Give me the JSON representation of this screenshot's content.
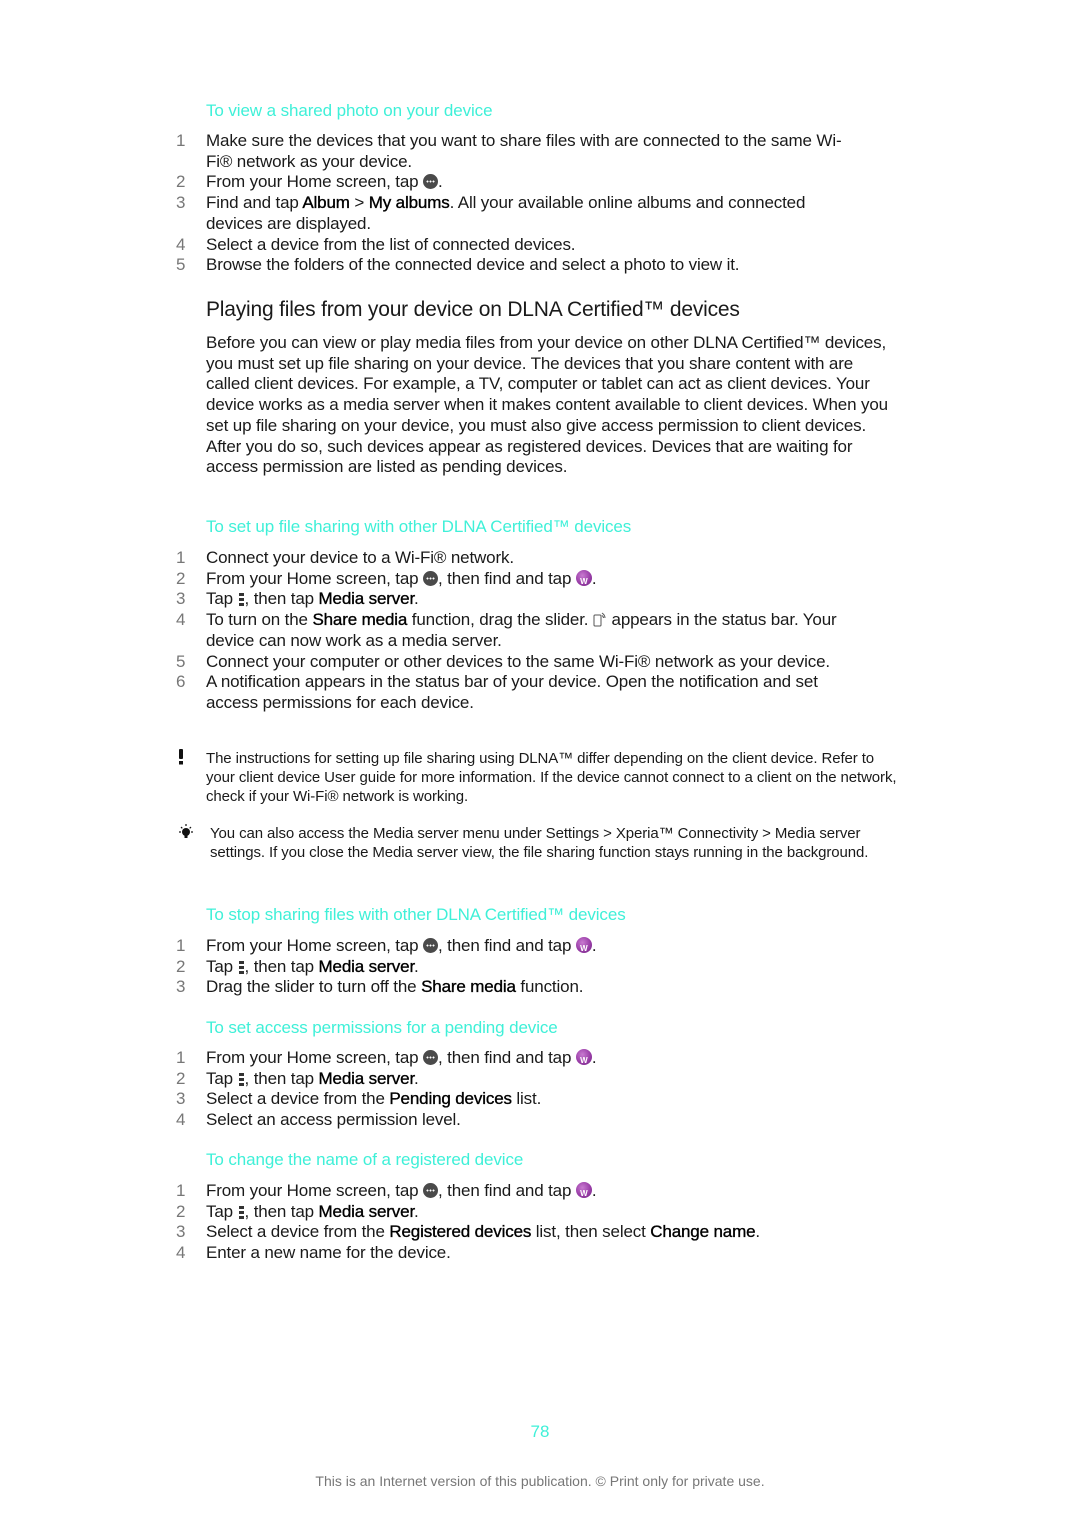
{
  "sections": {
    "view_shared_photo": {
      "title": "To view a shared photo on your device",
      "steps": [
        {
          "num": "1",
          "a": "Make sure the devices that you want to share files with are connected to the same Wi-Fi® network as your device."
        },
        {
          "num": "2",
          "a": "From your Home screen, tap ",
          "b": "."
        },
        {
          "num": "3",
          "a": "Find and tap ",
          "bold1": "Album",
          "mid": " > ",
          "bold2": "My albums",
          "b": ". All your available online albums and connected devices are displayed."
        },
        {
          "num": "4",
          "a": "Select a device from the list of connected devices."
        },
        {
          "num": "5",
          "a": "Browse the folders of the connected device and select a photo to view it."
        }
      ]
    },
    "dlna": {
      "heading": "Playing files from your device on DLNA Certified™ devices",
      "intro": "Before you can view or play media files from your device on other DLNA Certified™ devices, you must set up file sharing on your device. The devices that you share content with are called client devices. For example, a TV, computer or tablet can act as client devices. Your device works as a media server when it makes content available to client devices. When you set up file sharing on your device, you must also give access permission to client devices. After you do so, such devices appear as registered devices. Devices that are waiting for access permission are listed as pending devices."
    },
    "setup_sharing": {
      "title": "To set up file sharing with other DLNA Certified™ devices",
      "steps": [
        {
          "num": "1",
          "a": "Connect your device to a Wi-Fi® network."
        },
        {
          "num": "2",
          "a": "From your Home screen, tap ",
          "b": ", then find and tap ",
          "c": "."
        },
        {
          "num": "3",
          "a": "Tap ",
          "b": ", then tap ",
          "bold": "Media server",
          "c": "."
        },
        {
          "num": "4",
          "a": "To turn on the ",
          "bold": "Share media",
          "b": " function, drag the slider. ",
          "c": " appears in the status bar. Your device can now work as a media server."
        },
        {
          "num": "5",
          "a": "Connect your computer or other devices to the same Wi-Fi® network as your device."
        },
        {
          "num": "6",
          "a": "A notification appears in the status bar of your device. Open the notification and set access permissions for each device."
        }
      ]
    },
    "note": "The instructions for setting up file sharing using DLNA™ differ depending on the client device. Refer to your client device User guide for more information. If the device cannot connect to a client on the network, check if your Wi-Fi® network is working.",
    "tip": "You can also access the Media server menu under Settings > Xperia™ Connectivity > Media server settings. If you close the Media server view, the file sharing function stays running in the background.",
    "stop_sharing": {
      "title": "To stop sharing files with other DLNA Certified™ devices",
      "steps": [
        {
          "num": "1",
          "a": "From your Home screen, tap ",
          "b": ", then find and tap ",
          "c": "."
        },
        {
          "num": "2",
          "a": "Tap ",
          "b": ", then tap ",
          "bold": "Media server",
          "c": "."
        },
        {
          "num": "3",
          "a": "Drag the slider to turn off the ",
          "bold": "Share media",
          "b": " function."
        }
      ]
    },
    "pending_permissions": {
      "title": "To set access permissions for a pending device",
      "steps": [
        {
          "num": "1",
          "a": "From your Home screen, tap ",
          "b": ", then find and tap ",
          "c": "."
        },
        {
          "num": "2",
          "a": "Tap ",
          "b": ", then tap ",
          "bold": "Media server",
          "c": "."
        },
        {
          "num": "3",
          "a": "Select a device from the ",
          "bold": "Pending devices",
          "b": " list."
        },
        {
          "num": "4",
          "a": "Select an access permission level."
        }
      ]
    },
    "change_name": {
      "title": "To change the name of a registered device",
      "steps": [
        {
          "num": "1",
          "a": "From your Home screen, tap ",
          "b": ", then find and tap ",
          "c": "."
        },
        {
          "num": "2",
          "a": "Tap ",
          "b": ", then tap ",
          "bold": "Media server",
          "c": "."
        },
        {
          "num": "3",
          "a": "Select a device from the ",
          "bold1": "Registered devices",
          "b": " list, then select ",
          "bold2": "Change name",
          "c": "."
        },
        {
          "num": "4",
          "a": "Enter a new name for the device."
        }
      ]
    }
  },
  "icons": {
    "apps": "apps-grid-icon",
    "walkman": "walkman-music-icon",
    "menu": "overflow-menu-icon",
    "share": "media-server-status-icon",
    "note": "exclamation-icon",
    "tip": "lightbulb-icon"
  },
  "colors": {
    "heading_accent": "#3ff0d8",
    "body_text": "#1a1a1a",
    "step_number": "#777777"
  },
  "footer": {
    "page_number": "78",
    "notice": "This is an Internet version of this publication. © Print only for private use."
  }
}
